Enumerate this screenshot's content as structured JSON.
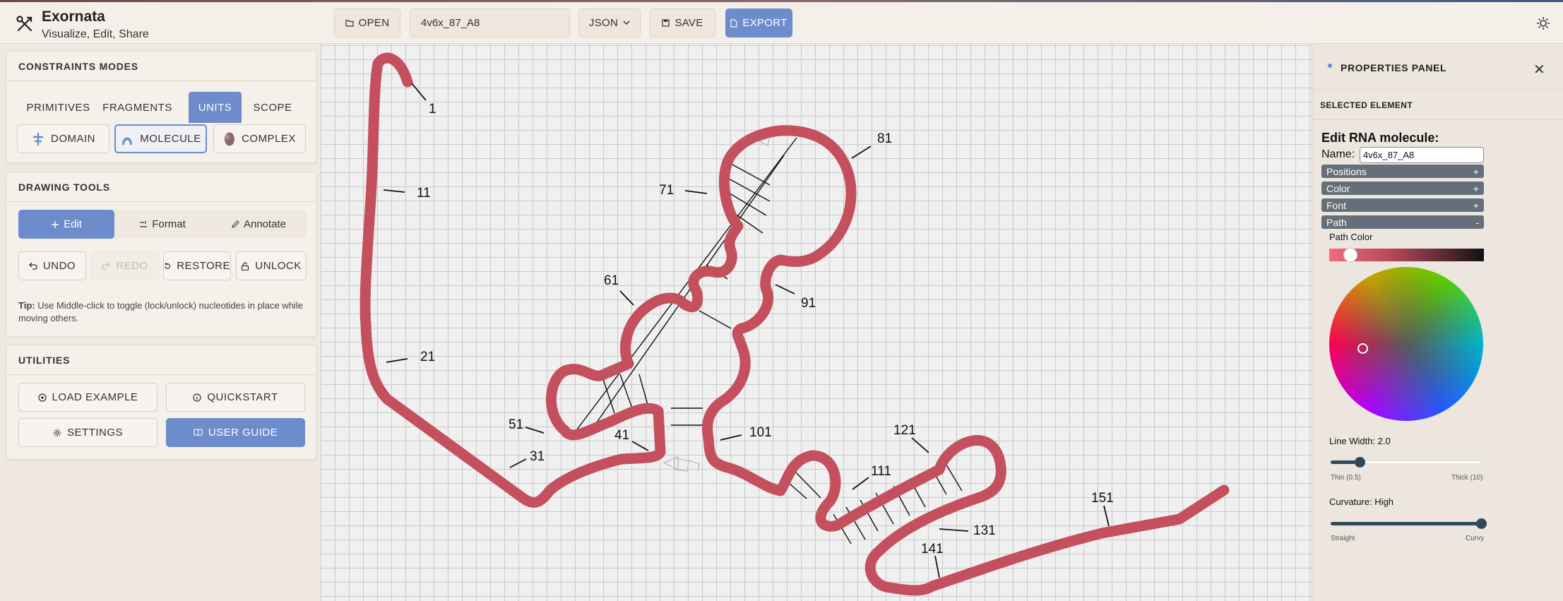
{
  "app": {
    "title": "Exornata",
    "subtitle": "Visualize, Edit, Share",
    "brand_icon": "scissors-pen-icon"
  },
  "toolbar": {
    "open_label": "OPEN",
    "filename": "4v6x_87_A8",
    "format_label": "JSON",
    "save_label": "SAVE",
    "export_label": "EXPORT",
    "theme_icon": "sun-icon"
  },
  "constraints": {
    "title": "CONSTRAINTS MODES",
    "tabs": [
      "PRIMITIVES",
      "FRAGMENTS",
      "UNITS",
      "SCOPE"
    ],
    "active_tab": "UNITS",
    "modes": [
      "DOMAIN",
      "MOLECULE",
      "COMPLEX"
    ],
    "active_mode": "MOLECULE"
  },
  "drawing": {
    "title": "DRAWING TOOLS",
    "segments": [
      "Edit",
      "Format",
      "Annotate"
    ],
    "active_segment": "Edit",
    "actions": [
      "UNDO",
      "REDO",
      "RESTORE",
      "UNLOCK"
    ],
    "tip_bold": "Tip:",
    "tip_text": " Use Middle-click to toggle (lock/unlock) nucleotides in place while moving others."
  },
  "utilities": {
    "title": "UTILITIES",
    "buttons": [
      "LOAD EXAMPLE",
      "QUICKSTART",
      "SETTINGS",
      "USER GUIDE"
    ]
  },
  "canvas": {
    "strand_color": "#c4505e",
    "position_labels": [
      "1",
      "11",
      "21",
      "31",
      "41",
      "51",
      "61",
      "71",
      "81",
      "91",
      "101",
      "111",
      "121",
      "131",
      "141",
      "151"
    ]
  },
  "properties": {
    "title": "PROPERTIES PANEL",
    "selected_label": "SELECTED ELEMENT",
    "heading": "Edit RNA molecule:",
    "name_label": "Name:",
    "name_value": "4v6x_87_A8",
    "sections": [
      {
        "label": "Positions",
        "sign": "+"
      },
      {
        "label": "Color",
        "sign": "+"
      },
      {
        "label": "Font",
        "sign": "+"
      },
      {
        "label": "Path",
        "sign": "-"
      }
    ],
    "path_color_label": "Path Color",
    "line_width_label": "Line Width: 2.0",
    "line_width_value": 2.0,
    "line_width_min": "Thin (0.5)",
    "line_width_max": "Thick (10)",
    "curvature_label": "Curvature: High",
    "curvature_min": "Straight",
    "curvature_max": "Curvy"
  }
}
